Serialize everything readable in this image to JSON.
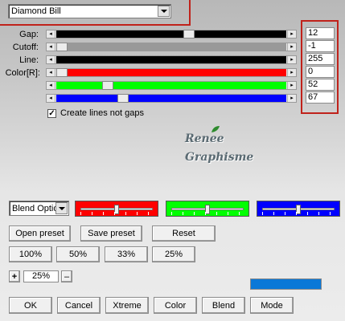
{
  "preset_combo": {
    "value": "Diamond Bill"
  },
  "sliders": [
    {
      "label": "Gap:",
      "value": "12",
      "fill_color": "#000000",
      "fraction": 0.58
    },
    {
      "label": "Cutoff:",
      "value": "-1",
      "fill_color": "#999999",
      "fraction": 0.0
    },
    {
      "label": "Line:",
      "value": "255",
      "fill_color": "#000000",
      "fraction": 1.0
    },
    {
      "label": "Color[R]:",
      "value": "0",
      "fill_color": "#ff0000",
      "fraction": 0.0
    },
    {
      "label": "",
      "value": "52",
      "fill_color": "#00ff00",
      "fraction": 0.21
    },
    {
      "label": "",
      "value": "67",
      "fill_color": "#0000ff",
      "fraction": 0.28
    }
  ],
  "create_lines_checkbox": {
    "label": "Create lines not gaps",
    "checked": true,
    "mark": "✓"
  },
  "watermark": {
    "line1": "Renee",
    "line2": "Graphisme"
  },
  "blend_combo": {
    "value": "Blend Optio"
  },
  "channel_bars": [
    {
      "color": "#ff0000",
      "level": 0.5
    },
    {
      "color": "#00ff00",
      "level": 0.5
    },
    {
      "color": "#0000ff",
      "level": 0.5
    }
  ],
  "preset_buttons": {
    "open": "Open preset",
    "save": "Save preset",
    "reset": "Reset"
  },
  "zoom_buttons": [
    "100%",
    "50%",
    "33%",
    "25%"
  ],
  "zoom": {
    "plus": "+",
    "value": "25%",
    "minus": "–"
  },
  "preview_color": "#0a78d7",
  "footer_buttons": {
    "ok": "OK",
    "cancel": "Cancel",
    "xtreme": "Xtreme",
    "color": "Color",
    "blend": "Blend",
    "mode": "Mode"
  }
}
